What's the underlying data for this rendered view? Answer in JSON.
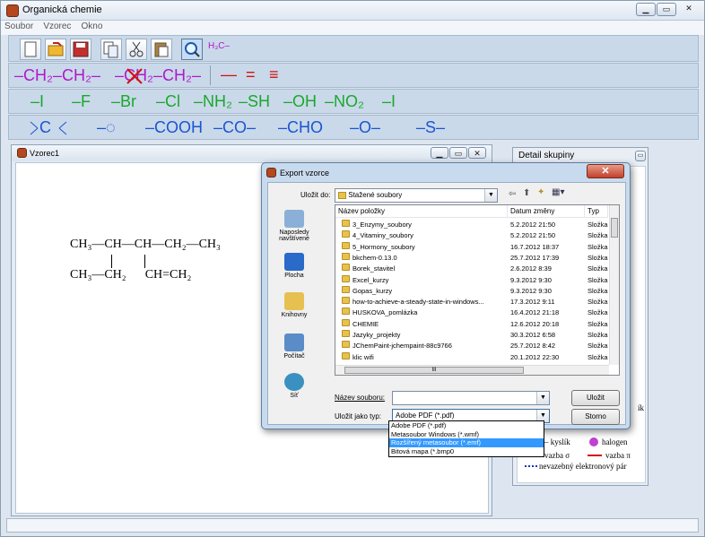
{
  "app": {
    "title": "Organická chemie"
  },
  "menu": [
    "Soubor",
    "Vzorec",
    "Okno"
  ],
  "toolbar": {
    "formula_label": "H₃C–"
  },
  "groups": {
    "row1": [
      "–CH₂–CH₂–",
      "–CH₂–CH₂–",
      "—",
      "=",
      "≡"
    ],
    "row2": [
      "–I",
      "–F",
      "–Br",
      "–Cl",
      "–NH₂",
      "–SH",
      "–OH",
      "–NO₂",
      "–I"
    ],
    "row3": [
      "C",
      "–◌",
      "–COOH",
      "–CO–",
      "–CHO",
      "–O–",
      "–S–"
    ]
  },
  "child_window": {
    "title": "Vzorec1"
  },
  "molecule": {
    "line1": [
      "CH₃",
      "—",
      "CH",
      "—",
      "CH",
      "—",
      "CH₂",
      "—",
      "CH₃"
    ],
    "line2": [
      "CH₃",
      "—",
      "CH₂",
      "CH",
      "=",
      "CH₂"
    ]
  },
  "detail": {
    "title": "Detail skupiny",
    "legend": [
      "– kyslík",
      "halogen",
      "vazba σ",
      "vazba π",
      "nevazebný elektronový pár"
    ],
    "partial": "ík"
  },
  "dialog": {
    "title": "Export vzorce",
    "save_in_label": "Uložit do:",
    "save_in_value": "Stažené soubory",
    "places": [
      "Naposledy navštívené",
      "Plocha",
      "Knihovny",
      "Počítač",
      "Síť"
    ],
    "columns": [
      "Název položky",
      "Datum změny",
      "Typ"
    ],
    "files": [
      {
        "name": "3_Enzymy_soubory",
        "date": "5.2.2012 21:50",
        "type": "Složka"
      },
      {
        "name": "4_Vitaminy_soubory",
        "date": "5.2.2012 21:50",
        "type": "Složka"
      },
      {
        "name": "5_Hormony_soubory",
        "date": "16.7.2012 18:37",
        "type": "Složka"
      },
      {
        "name": "bkchem-0.13.0",
        "date": "25.7.2012 17:39",
        "type": "Složka"
      },
      {
        "name": "Borek_stavitel",
        "date": "2.6.2012 8:39",
        "type": "Složka"
      },
      {
        "name": "Excel_kurzy",
        "date": "9.3.2012 9:30",
        "type": "Složka"
      },
      {
        "name": "Gopas_kurzy",
        "date": "9.3.2012 9:30",
        "type": "Složka"
      },
      {
        "name": "how-to-achieve-a-steady-state-in-windows...",
        "date": "17.3.2012 9:11",
        "type": "Složka"
      },
      {
        "name": "HUSKOVA_pomlázka",
        "date": "16.4.2012 21:18",
        "type": "Složka"
      },
      {
        "name": "CHEMIE",
        "date": "12.6.2012 20:18",
        "type": "Složka"
      },
      {
        "name": "Jazyky_projekty",
        "date": "30.3.2012 6:58",
        "type": "Složka"
      },
      {
        "name": "JChemPaint-jchempaint-88c9766",
        "date": "25.7.2012 8:42",
        "type": "Složka"
      },
      {
        "name": "klic wifi",
        "date": "20.1.2012 22:30",
        "type": "Složka"
      }
    ],
    "filename_label": "Název souboru:",
    "filename_value": "",
    "type_label": "Uložit jako typ:",
    "type_value": "Adobe PDF (*.pdf)",
    "type_options": [
      "Adobe PDF (*.pdf)",
      "Metasoubor Windows (*.wmf)",
      "Rozšířený metasoubor (*.emf)",
      "Bitová mapa (*.bmp0"
    ],
    "save_button": "Uložit",
    "cancel_button": "Storno",
    "hscroll_mark": "III"
  }
}
